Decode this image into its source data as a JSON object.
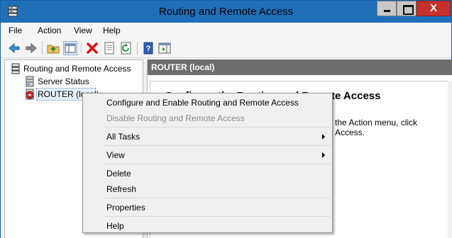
{
  "window": {
    "title": "Routing and Remote Access",
    "close_glyph": "X",
    "icons": {
      "app": "router-server-icon",
      "minimize": "minimize-icon",
      "maximize": "maximize-icon",
      "close": "close-icon"
    }
  },
  "menubar": {
    "items": [
      "File",
      "Action",
      "View",
      "Help"
    ]
  },
  "toolbar": {
    "buttons": [
      "back-arrow-icon",
      "forward-arrow-icon",
      "up-folder-icon",
      "show-hide-tree-icon",
      "delete-icon",
      "properties-icon",
      "refresh-icon",
      "help-icon",
      "show-action-pane-icon"
    ]
  },
  "tree": {
    "root": {
      "label": "Routing and Remote Access",
      "icon": "router-server-icon"
    },
    "items": [
      {
        "label": "Server Status",
        "icon": "server-status-icon"
      },
      {
        "label": "ROUTER (local)",
        "icon": "router-stopped-icon"
      }
    ]
  },
  "result": {
    "header": "ROUTER (local)",
    "heading": "Configure the Routing and Remote Access",
    "line1": "the Action menu, click",
    "line2": "Access."
  },
  "context_menu": {
    "configure": "Configure and Enable Routing and Remote Access",
    "disable": "Disable Routing and Remote Access",
    "all_tasks": "All Tasks",
    "view": "View",
    "delete": "Delete",
    "refresh": "Refresh",
    "properties": "Properties",
    "help": "Help"
  },
  "colors": {
    "titlebar": "#1f6fb9",
    "close": "#c7312c",
    "pane_header": "#6d6d6d",
    "stopped": "#d62828"
  }
}
